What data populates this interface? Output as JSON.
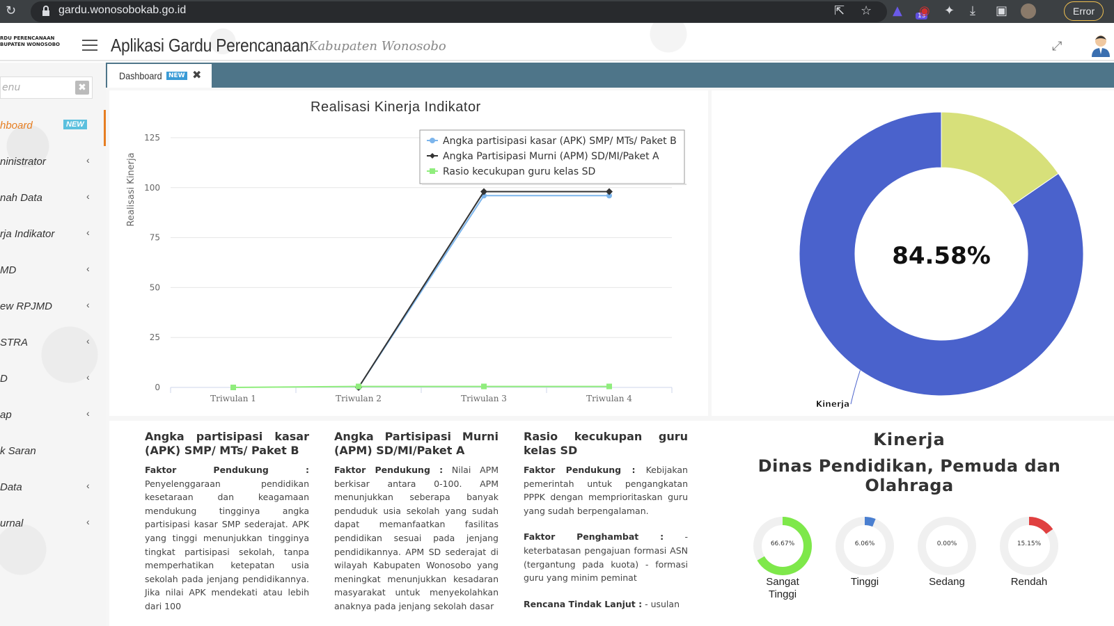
{
  "browser": {
    "url": "gardu.wonosobokab.go.id",
    "ext_badge": "13",
    "error_label": "Error"
  },
  "header": {
    "logo_line1": "RDU PERENCANAAN",
    "logo_line2": "BUPATEN WONOSOBO",
    "title": "Aplikasi Gardu Perencanaan",
    "subtitle": "Kabupaten Wonosobo"
  },
  "sidebar": {
    "search_placeholder": "enu",
    "items": [
      {
        "label": "hboard",
        "badge": "NEW",
        "active": true
      },
      {
        "label": "ninistrator"
      },
      {
        "label": "nah Data"
      },
      {
        "label": "rja Indikator"
      },
      {
        "label": "MD"
      },
      {
        "label": "ew RPJMD"
      },
      {
        "label": "STRA"
      },
      {
        "label": "D"
      },
      {
        "label": "ap"
      },
      {
        "label": "k Saran"
      },
      {
        "label": " Data"
      },
      {
        "label": "urnal"
      }
    ]
  },
  "tabs": [
    {
      "label": "Dashboard",
      "badge": "NEW"
    }
  ],
  "chart_data": [
    {
      "type": "line",
      "title": "Realisasi Kinerja Indikator",
      "ylabel": "Realisasi Kinerja",
      "xlabel": "",
      "categories": [
        "Triwulan 1",
        "Triwulan 2",
        "Triwulan 3",
        "Triwulan 4"
      ],
      "ylim": [
        0,
        125
      ],
      "yticks": [
        0,
        25,
        50,
        75,
        100,
        125
      ],
      "grid": true,
      "legend_position": "top-right",
      "series": [
        {
          "name": "Angka partisipasi kasar (APK) SMP/ MTs/ Paket B",
          "color": "#7cb5ec",
          "values": [
            null,
            0,
            96,
            96
          ]
        },
        {
          "name": "Angka Partisipasi Murni (APM) SD/MI/Paket A",
          "color": "#333333",
          "values": [
            null,
            0,
            98,
            98
          ]
        },
        {
          "name": "Rasio kecukupan guru kelas SD",
          "color": "#90ed7d",
          "values": [
            0,
            0.5,
            0.5,
            0.5
          ]
        }
      ]
    },
    {
      "type": "pie",
      "center_label": "84.58%",
      "slice_label": "Kinerja",
      "slices": [
        {
          "name": "Kinerja",
          "value": 84.58,
          "color": "#4a62cc"
        },
        {
          "name": "",
          "value": 15.42,
          "color": "#d7e07a"
        }
      ]
    }
  ],
  "indicators": [
    {
      "title": "Angka partisipasi kasar (APK) SMP/ MTs/ Paket B",
      "pendukung_label": "Faktor Pendukung :",
      "pendukung_text": "Penyelenggaraan pendidikan kesetaraan dan keagamaan mendukung tingginya angka partisipasi kasar SMP sederajat. APK yang tinggi menunjukkan tingginya tingkat partisipasi sekolah, tanpa memperhatikan ketepatan usia sekolah pada jenjang pendidikannya. Jika nilai APK mendekati atau lebih dari 100"
    },
    {
      "title": "Angka Partisipasi Murni (APM) SD/MI/Paket A",
      "pendukung_label": "Faktor Pendukung :",
      "pendukung_text": "Nilai APM berkisar antara 0-100. APM menunjukkan seberapa banyak penduduk usia sekolah yang sudah dapat memanfaatkan fasilitas pendidikan sesuai pada jenjang pendidikannya. APM SD sederajat di wilayah Kabupaten Wonosobo yang meningkat menunjukkan kesadaran masyarakat untuk menyekolahkan anaknya pada jenjang sekolah dasar"
    },
    {
      "title": "Rasio kecukupan guru kelas SD",
      "pendukung_label": "Faktor Pendukung :",
      "pendukung_text": "Kebijakan pemerintah untuk pengangkatan PPPK dengan memprioritaskan guru yang sudah berpengalaman.",
      "penghambat_label": "Faktor Penghambat :",
      "penghambat_text": "- keterbatasan pengajuan formasi ASN (tergantung pada kuota) - formasi guru yang minim peminat",
      "rtl_label": "Rencana Tindak Lanjut :",
      "rtl_text": "- usulan"
    }
  ],
  "kinerja": {
    "title": "Kinerja",
    "subtitle": "Dinas Pendidikan, Pemuda dan Olahraga",
    "gauges": [
      {
        "label": "Sangat Tinggi",
        "value_text": "66.67%",
        "value": 66.67,
        "color": "#7ee84a"
      },
      {
        "label": "Tinggi",
        "value_text": "6.06%",
        "value": 6.06,
        "color": "#4a7fd0"
      },
      {
        "label": "Sedang",
        "value_text": "0.00%",
        "value": 0,
        "color": "#cccccc"
      },
      {
        "label": "Rendah",
        "value_text": "15.15%",
        "value": 15.15,
        "color": "#e04040"
      }
    ]
  }
}
